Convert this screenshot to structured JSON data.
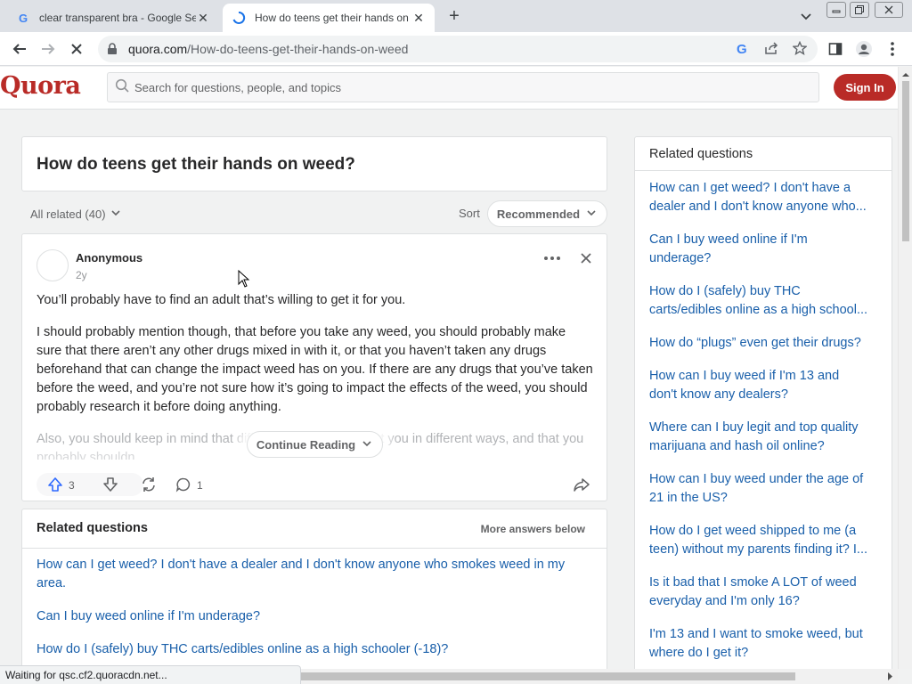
{
  "browser": {
    "tabs": [
      {
        "title": "clear transparent bra - Google Se",
        "active": false,
        "favicon": "google-g-icon"
      },
      {
        "title": "How do teens get their hands on",
        "active": true,
        "favicon": "loading-spinner-icon"
      }
    ],
    "url_domain": "quora.com",
    "url_path": "/How-do-teens-get-their-hands-on-weed",
    "status_text": "Waiting for qsc.cf2.quoracdn.net..."
  },
  "header": {
    "logo": "Quora",
    "search_placeholder": "Search for questions, people, and topics",
    "signin_label": "Sign In"
  },
  "question": {
    "title": "How do teens get their hands on weed?",
    "filter_label": "All related (40)",
    "sort_label": "Sort",
    "sort_value": "Recommended"
  },
  "answer": {
    "author": "Anonymous",
    "age": "2y",
    "paragraphs": [
      "You’ll probably have to find an adult that’s willing to get it for you.",
      "I should probably mention though, that before you take any weed, you should probably make sure that there aren’t any other drugs mixed in with it, or that you haven’t taken any drugs beforehand that can change the impact weed has on you. If there are any drugs that you’ve taken before the weed, and you’re not sure how it’s going to impact the effects of the weed, you should probably research it before doing anything."
    ],
    "faded_text": "Also, you should keep in mind that different strains can affect you in different ways, and that you",
    "faded_text_2": "probably shouldn",
    "continue_label": "Continue Reading",
    "upvotes": "3",
    "comments": "1"
  },
  "related_main": {
    "title": "Related questions",
    "more_label": "More answers below",
    "items": [
      "How can I get weed? I don't have a dealer and I don't know anyone who smokes weed in my area.",
      "Can I buy weed online if I'm underage?",
      "How do I (safely) buy THC carts/edibles online as a high schooler (-18)?"
    ]
  },
  "related_side": {
    "title": "Related questions",
    "items": [
      {
        "line1": "How can I get weed? I don't have a",
        "line2": "dealer and I don't know anyone who..."
      },
      {
        "line1": "Can I buy weed online if I'm",
        "line2": "underage?"
      },
      {
        "line1": "How do I (safely) buy THC",
        "line2": "carts/edibles online as a high school..."
      },
      {
        "line1": "How do “plugs” even get their drugs?",
        "line2": ""
      },
      {
        "line1": "How can I buy weed if I'm 13 and",
        "line2": "don't know any dealers?"
      },
      {
        "line1": "Where can I buy legit and top quality",
        "line2": "marijuana and hash oil online?"
      },
      {
        "line1": "How can I buy weed under the age of",
        "line2": "21 in the US?"
      },
      {
        "line1": "How do I get weed shipped to me (a",
        "line2": "teen) without my parents finding it? I..."
      },
      {
        "line1": "Is it bad that I smoke A LOT of weed",
        "line2": "everyday and I'm only 16?"
      },
      {
        "line1": "I'm 13 and I want to smoke weed, but",
        "line2": "where do I get it?"
      }
    ]
  },
  "colors": {
    "brand": "#b92b27",
    "link": "#195faa",
    "upvote": "#2e69ff"
  }
}
